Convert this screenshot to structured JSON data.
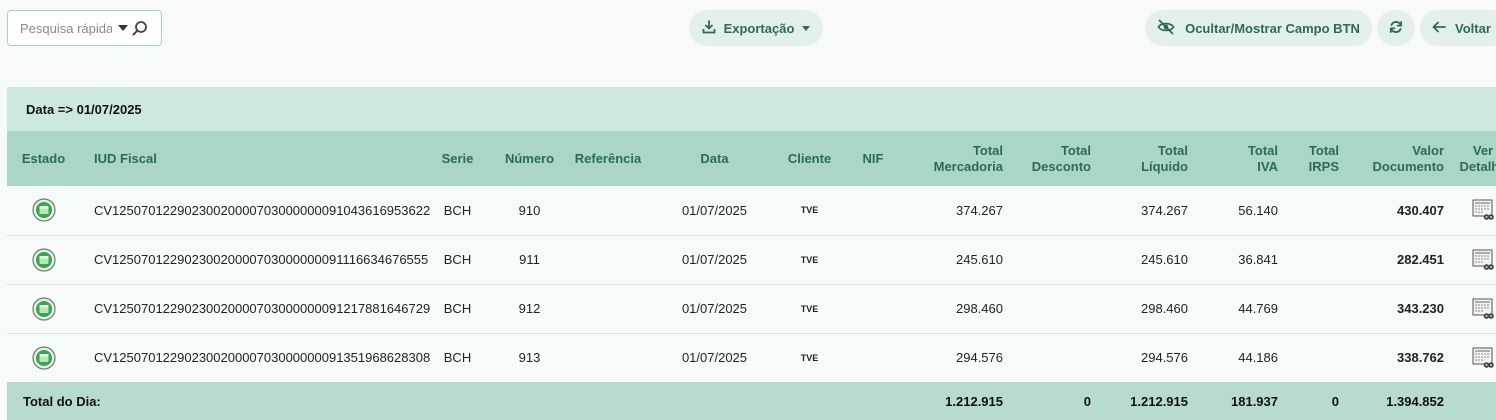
{
  "toolbar": {
    "search_placeholder": "Pesquisa rápida",
    "export_label": "Exportação",
    "toggle_label": "Ocultar/Mostrar Campo BTN",
    "back_label": "Voltar"
  },
  "date_header": "Data => 01/07/2025",
  "columns": {
    "estado": "Estado",
    "iud": "IUD Fiscal",
    "serie": "Serie",
    "numero": "Número",
    "referencia": "Referência",
    "data": "Data",
    "cliente": "Cliente",
    "nif": "NIF",
    "total_mercadoria_1": "Total",
    "total_mercadoria_2": "Mercadoria",
    "total_desconto_1": "Total",
    "total_desconto_2": "Desconto",
    "total_liquido_1": "Total",
    "total_liquido_2": "Líquido",
    "total_iva_1": "Total",
    "total_iva_2": "IVA",
    "total_irps_1": "Total",
    "total_irps_2": "IRPS",
    "valor_documento_1": "Valor",
    "valor_documento_2": "Documento",
    "ver_detalhe_1": "Ver",
    "ver_detalhe_2": "Detalhe"
  },
  "rows": [
    {
      "iud": "CV1250701229023002000070300000009104361695 3622",
      "serie": "BCH",
      "numero": "910",
      "referencia": "",
      "data": "01/07/2025",
      "cliente": "TVE",
      "nif": "",
      "total_mercadoria": "374.267",
      "total_desconto": "",
      "total_liquido": "374.267",
      "total_iva": "56.140",
      "total_irps": "",
      "valor_documento": "430.407"
    },
    {
      "iud": "CV1250701229023002000070300000009111663467 6555",
      "serie": "BCH",
      "numero": "911",
      "referencia": "",
      "data": "01/07/2025",
      "cliente": "TVE",
      "nif": "",
      "total_mercadoria": "245.610",
      "total_desconto": "",
      "total_liquido": "245.610",
      "total_iva": "36.841",
      "total_irps": "",
      "valor_documento": "282.451"
    },
    {
      "iud": "CV1250701229023002000070300000009121788164 6729",
      "serie": "BCH",
      "numero": "912",
      "referencia": "",
      "data": "01/07/2025",
      "cliente": "TVE",
      "nif": "",
      "total_mercadoria": "298.460",
      "total_desconto": "",
      "total_liquido": "298.460",
      "total_iva": "44.769",
      "total_irps": "",
      "valor_documento": "343.230"
    },
    {
      "iud": "CV1250701229023002000070300000009135196862 8308",
      "serie": "BCH",
      "numero": "913",
      "referencia": "",
      "data": "01/07/2025",
      "cliente": "TVE",
      "nif": "",
      "total_mercadoria": "294.576",
      "total_desconto": "",
      "total_liquido": "294.576",
      "total_iva": "44.186",
      "total_irps": "",
      "valor_documento": "338.762"
    }
  ],
  "totals": {
    "label": "Total do Dia:",
    "total_mercadoria": "1.212.915",
    "total_desconto": "0",
    "total_liquido": "1.212.915",
    "total_iva": "181.937",
    "total_irps": "0",
    "valor_documento": "1.394.852"
  },
  "icons": {
    "search": "search-icon",
    "export": "download-icon",
    "toggle": "eye-slash-icon",
    "refresh": "refresh-icon",
    "back": "arrow-left-icon",
    "status": "status-ok-icon",
    "detail": "document-detail-icon"
  },
  "colors": {
    "accent": "#2e6b57",
    "header_bg": "#a9d6c6",
    "date_band_bg": "#cde8df",
    "footer_bg": "#b7dbce",
    "status_green": "#3aa64a"
  }
}
